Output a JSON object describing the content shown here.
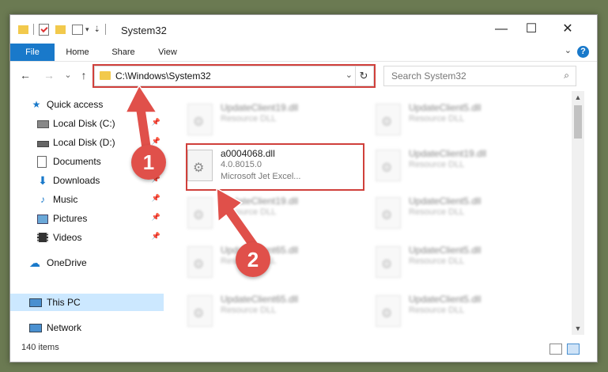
{
  "window": {
    "title": "System32",
    "controls": {
      "minimize": "—",
      "maximize": "☐",
      "close": "✕"
    }
  },
  "ribbon": {
    "tabs": [
      "File",
      "Home",
      "Share",
      "View"
    ],
    "help": "?"
  },
  "navigation": {
    "back": "←",
    "forward": "→",
    "recent": "⌄",
    "up": "↑",
    "address": "C:\\Windows\\System32",
    "search_placeholder": "Search System32"
  },
  "sidebar": {
    "items": [
      {
        "label": "Quick access",
        "icon": "star-icon",
        "pinned": false
      },
      {
        "label": "Local Disk (C:)",
        "icon": "drive-icon",
        "pinned": true
      },
      {
        "label": "Local Disk (D:)",
        "icon": "drive-icon",
        "pinned": true
      },
      {
        "label": "Documents",
        "icon": "document-icon",
        "pinned": true
      },
      {
        "label": "Downloads",
        "icon": "download-icon",
        "pinned": true
      },
      {
        "label": "Music",
        "icon": "music-icon",
        "pinned": true
      },
      {
        "label": "Pictures",
        "icon": "picture-icon",
        "pinned": true
      },
      {
        "label": "Videos",
        "icon": "video-icon",
        "pinned": true
      },
      {
        "label": "OneDrive",
        "icon": "cloud-icon",
        "pinned": false
      },
      {
        "label": "This PC",
        "icon": "computer-icon",
        "pinned": false,
        "selected": true
      },
      {
        "label": "Network",
        "icon": "network-icon",
        "pinned": false
      }
    ]
  },
  "files": {
    "left_column": [
      {
        "name": "UpdateClient19.dll",
        "type": "Resource DLL"
      },
      {
        "name": "a0004068.dll",
        "version": "4.0.8015.0",
        "description": "Microsoft Jet Excel...",
        "highlighted": true
      },
      {
        "name": "UpdateClient19.dll",
        "type": "Resource DLL"
      },
      {
        "name": "UpdateClient65.dll",
        "type": "Resource DLL"
      },
      {
        "name": "UpdateClient65.dll",
        "type": "Resource DLL"
      }
    ],
    "right_column": [
      {
        "name": "UpdateClient5.dll",
        "type": "Resource DLL"
      },
      {
        "name": "UpdateClient19.dll",
        "type": "Resource DLL"
      },
      {
        "name": "UpdateClient5.dll",
        "type": "Resource DLL"
      },
      {
        "name": "UpdateClient5.dll",
        "type": "Resource DLL"
      },
      {
        "name": "UpdateClient5.dll",
        "type": "Resource DLL"
      }
    ]
  },
  "status": {
    "item_count": "140 items"
  },
  "annotations": {
    "step1": "1",
    "step2": "2",
    "color": "#e0504a"
  }
}
